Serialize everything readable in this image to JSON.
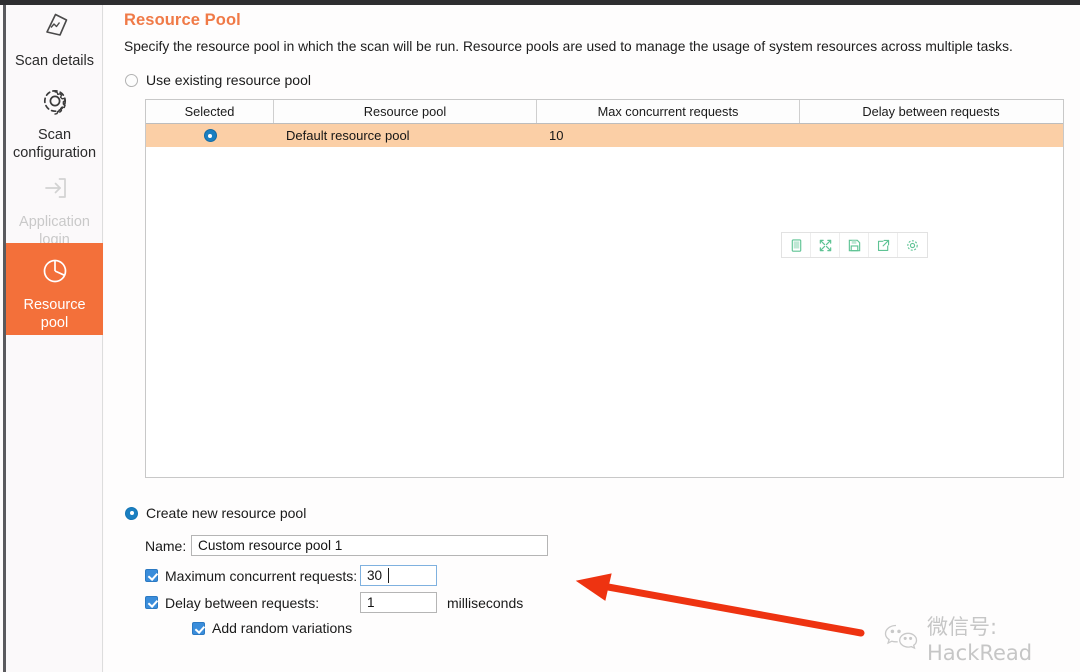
{
  "sidebar": {
    "items": [
      {
        "id": "scan-details",
        "label": "Scan details",
        "icon": "scan-details-icon",
        "active": false,
        "disabled": false
      },
      {
        "id": "scan-config",
        "label": "Scan\nconfiguration",
        "icon": "gear-icon",
        "active": false,
        "disabled": false
      },
      {
        "id": "app-login",
        "label": "Application\nlogin",
        "icon": "login-arrow-icon",
        "active": false,
        "disabled": true
      },
      {
        "id": "resource-pool",
        "label": "Resource\npool",
        "icon": "pie-chart-icon",
        "active": true,
        "disabled": false
      }
    ],
    "labels": {
      "scan_details": "Scan details",
      "scan_config_line1": "Scan",
      "scan_config_line2": "configuration",
      "app_login_line1": "Application",
      "app_login_line2": "login",
      "resource_pool_line1": "Resource",
      "resource_pool_line2": "pool"
    }
  },
  "page": {
    "title": "Resource Pool",
    "description": "Specify the resource pool in which the scan will be run. Resource pools are used to manage the usage of system resources across multiple tasks.",
    "accent_color": "#f07a47",
    "active_sidebar_color": "#f3703a"
  },
  "existing": {
    "radio_label": "Use existing resource pool",
    "selected": false,
    "table": {
      "columns": [
        "Selected",
        "Resource pool",
        "Max concurrent requests",
        "Delay between requests"
      ],
      "rows": [
        {
          "selected": true,
          "resource_pool": "Default resource pool",
          "max_concurrent_requests": "10",
          "delay_between_requests": ""
        }
      ],
      "highlight_color": "#fbcfa6"
    },
    "toolbar_icons": [
      "device-icon",
      "expand-icon",
      "save-icon",
      "export-icon",
      "settings-gear-icon"
    ]
  },
  "create_new": {
    "radio_label": "Create new resource pool",
    "selected": true,
    "name_label": "Name:",
    "name_value": "Custom resource pool 1",
    "name_placeholder": "",
    "max_label": "Maximum concurrent requests:",
    "max_checked": true,
    "max_value": "30",
    "delay_label": "Delay between requests:",
    "delay_checked": true,
    "delay_value": "1",
    "delay_units": "milliseconds",
    "random_label": "Add random variations",
    "random_checked": true
  },
  "annotation": {
    "arrow_color": "#ee3311",
    "points_to": "Maximum concurrent requests field"
  },
  "watermark": {
    "text": "微信号: HackRead",
    "icon": "wechat-icon",
    "color": "#c6c6c6"
  }
}
